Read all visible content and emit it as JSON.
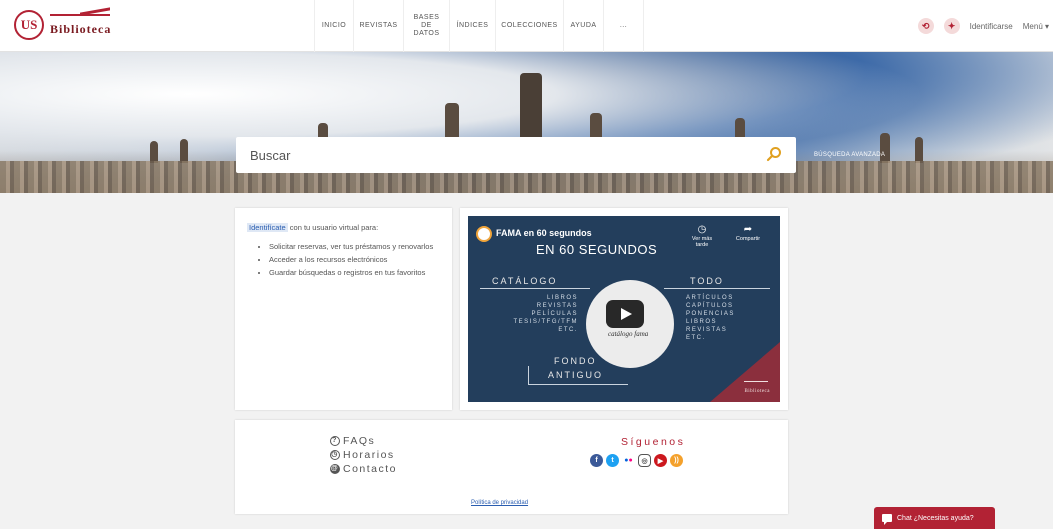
{
  "header": {
    "logo_initials": "US",
    "logo_name": "Biblioteca",
    "nav": [
      {
        "label": "Inicio"
      },
      {
        "label": "Revistas"
      },
      {
        "label": "Bases de datos"
      },
      {
        "label": "Índices"
      },
      {
        "label": "Colecciones"
      },
      {
        "label": "Ayuda"
      },
      {
        "label": "..."
      }
    ],
    "identify_label": "Identificarse",
    "menu_label": "Menú ▾"
  },
  "search": {
    "placeholder": "Buscar",
    "advanced_label": "Búsqueda avanzada"
  },
  "login_card": {
    "identify_link": "Identifícate",
    "intro": " con tu usuario virtual para:",
    "items": [
      "Solicitar reservas, ver tus préstamos y renovarlos",
      "Acceder a los recursos electrónicos",
      "Guardar búsquedas o registros en tus favoritos"
    ]
  },
  "video": {
    "title": "FAMA en 60 segundos",
    "watch_later": "Ver más tarde",
    "share": "Compartir",
    "heading": "EN 60 SEGUNDOS",
    "left_head": "CATÁLOGO",
    "left_items": [
      "LIBROS",
      "REVISTAS",
      "PELÍCULAS",
      "TESIS/TFG/TFM",
      "ETC."
    ],
    "right_head": "TODO",
    "right_items": [
      "ARTÍCULOS",
      "CAPÍTULOS",
      "PONENCIAS",
      "LIBROS",
      "REVISTAS",
      "ETC."
    ],
    "bottom_head_1": "FONDO",
    "bottom_head_2": "ANTIGUO",
    "circle_text": "catálogo fama",
    "brand": "Biblioteca"
  },
  "footer": {
    "links": [
      {
        "icon": "?",
        "label": "FAQs"
      },
      {
        "icon": "◷",
        "label": "Horarios"
      },
      {
        "icon": "@",
        "label": "Contacto"
      }
    ],
    "follow_title": "Síguenos",
    "privacy": "Política de privacidad"
  },
  "chat": {
    "label": "Chat ¿Necesitas ayuda?"
  },
  "colors": {
    "brand_red": "#b22234",
    "link_blue": "#2a5db0",
    "video_bg": "#233e5c"
  }
}
